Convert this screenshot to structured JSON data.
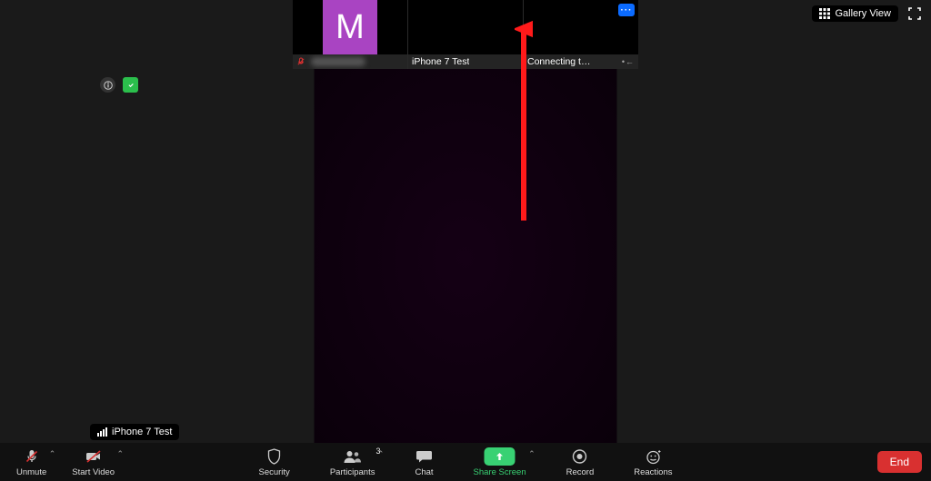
{
  "thumbnails": [
    {
      "avatar_letter": "M",
      "muted": true
    },
    {
      "name": "iPhone 7 Test"
    },
    {
      "name": "Connecting t…",
      "has_more_menu": true,
      "connecting": true
    }
  ],
  "top_right": {
    "gallery_label": "Gallery View"
  },
  "audio_source": {
    "label": "iPhone 7 Test"
  },
  "controls": {
    "unmute_label": "Unmute",
    "start_video_label": "Start Video",
    "security_label": "Security",
    "participants_label": "Participants",
    "participants_count": "3",
    "chat_label": "Chat",
    "share_label": "Share Screen",
    "record_label": "Record",
    "reactions_label": "Reactions",
    "end_label": "End"
  },
  "colors": {
    "accent_blue": "#0b6bff",
    "accent_green": "#38d173",
    "accent_red": "#d93030",
    "avatar_purple": "#a944c2"
  }
}
